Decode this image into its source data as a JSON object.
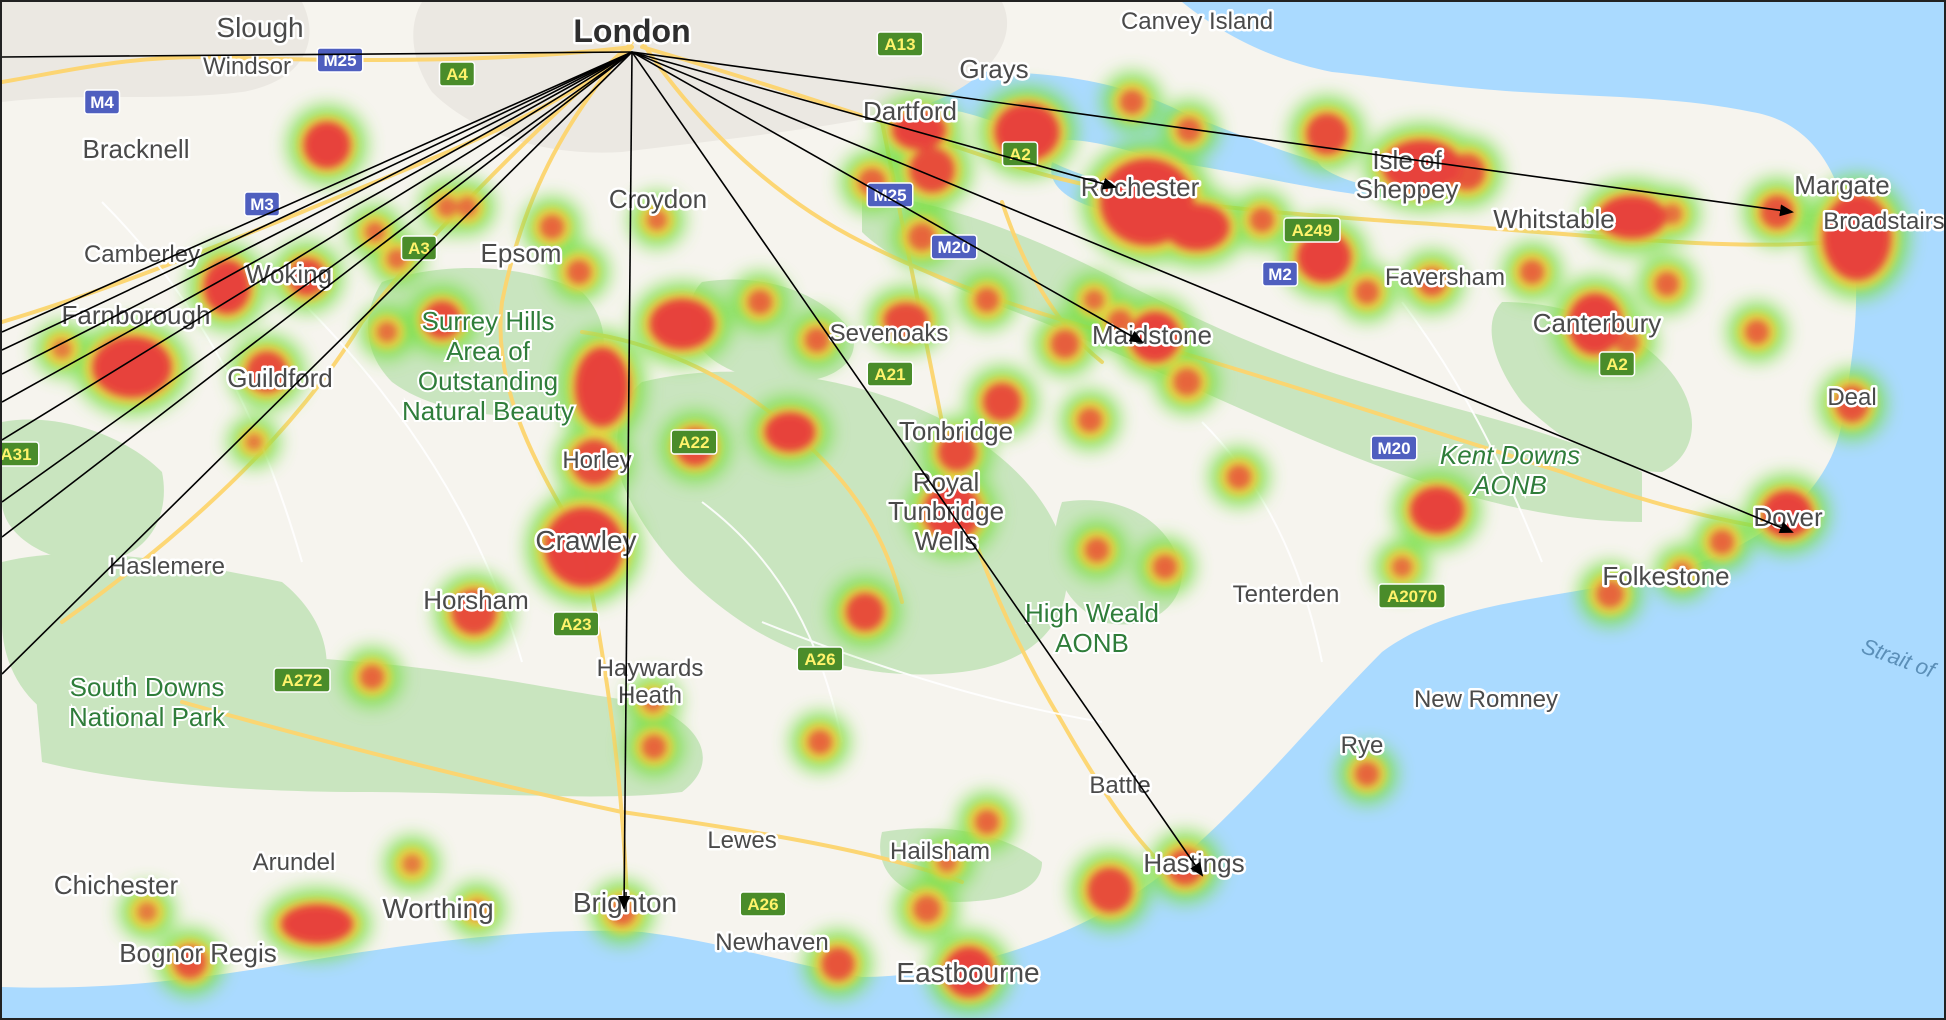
{
  "colors": {
    "sea": "#aadaff",
    "land": "#f6f4ee",
    "park": "#c9e5bf",
    "major_road": "#fdd56e",
    "motorway_badge": "#4f5fbf",
    "a_road_badge": "#4a8c2a",
    "a_road_badge_text": "#fff36b",
    "heat_core": "#e8333a",
    "heat_halo": "#7be049",
    "arrow": "#000000"
  },
  "map": {
    "origin": "London",
    "place_labels": [
      {
        "id": "slough",
        "text": "Slough"
      },
      {
        "id": "windsor",
        "text": "Windsor"
      },
      {
        "id": "london",
        "text": "London"
      },
      {
        "id": "canvey",
        "text": "Canvey Island"
      },
      {
        "id": "grays",
        "text": "Grays"
      },
      {
        "id": "bracknell",
        "text": "Bracknell"
      },
      {
        "id": "dartford",
        "text": "Dartford"
      },
      {
        "id": "rochester",
        "text": "Rochester"
      },
      {
        "id": "sheppey1",
        "text": "Isle of"
      },
      {
        "id": "sheppey2",
        "text": "Sheppey"
      },
      {
        "id": "margate",
        "text": "Margate"
      },
      {
        "id": "broadstairs",
        "text": "Broadstairs"
      },
      {
        "id": "whitstable",
        "text": "Whitstable"
      },
      {
        "id": "croydon",
        "text": "Croydon"
      },
      {
        "id": "camberley",
        "text": "Camberley"
      },
      {
        "id": "epsom",
        "text": "Epsom"
      },
      {
        "id": "woking",
        "text": "Woking"
      },
      {
        "id": "farnborough",
        "text": "Farnborough"
      },
      {
        "id": "guildford",
        "text": "Guildford"
      },
      {
        "id": "faversham",
        "text": "Faversham"
      },
      {
        "id": "sevenoaks",
        "text": "Sevenoaks"
      },
      {
        "id": "maidstone",
        "text": "Maidstone"
      },
      {
        "id": "canterbury",
        "text": "Canterbury"
      },
      {
        "id": "deal",
        "text": "Deal"
      },
      {
        "id": "tonbridge",
        "text": "Tonbridge"
      },
      {
        "id": "horley",
        "text": "Horley"
      },
      {
        "id": "rtw1",
        "text": "Royal"
      },
      {
        "id": "rtw2",
        "text": "Tunbridge"
      },
      {
        "id": "rtw3",
        "text": "Wells"
      },
      {
        "id": "dover",
        "text": "Dover"
      },
      {
        "id": "crawley",
        "text": "Crawley"
      },
      {
        "id": "haslemere",
        "text": "Haslemere"
      },
      {
        "id": "folkestone",
        "text": "Folkestone"
      },
      {
        "id": "horsham",
        "text": "Horsham"
      },
      {
        "id": "tenterden",
        "text": "Tenterden"
      },
      {
        "id": "hh1",
        "text": "Haywards"
      },
      {
        "id": "hh2",
        "text": "Heath"
      },
      {
        "id": "newromney",
        "text": "New Romney"
      },
      {
        "id": "rye",
        "text": "Rye"
      },
      {
        "id": "battle",
        "text": "Battle"
      },
      {
        "id": "arundel",
        "text": "Arundel"
      },
      {
        "id": "lewes",
        "text": "Lewes"
      },
      {
        "id": "hailsham",
        "text": "Hailsham"
      },
      {
        "id": "hastings",
        "text": "Hastings"
      },
      {
        "id": "chichester",
        "text": "Chichester"
      },
      {
        "id": "worthing",
        "text": "Worthing"
      },
      {
        "id": "brighton",
        "text": "Brighton"
      },
      {
        "id": "newhaven",
        "text": "Newhaven"
      },
      {
        "id": "eastbourne",
        "text": "Eastbourne"
      },
      {
        "id": "bognor",
        "text": "Bognor Regis"
      }
    ],
    "park_labels": [
      {
        "id": "surrey1",
        "text": "Surrey Hills"
      },
      {
        "id": "surrey2",
        "text": "Area of"
      },
      {
        "id": "surrey3",
        "text": "Outstanding"
      },
      {
        "id": "surrey4",
        "text": "Natural Beauty"
      },
      {
        "id": "kent1",
        "text": "Kent Downs"
      },
      {
        "id": "kent2",
        "text": "AONB"
      },
      {
        "id": "hw1",
        "text": "High Weald"
      },
      {
        "id": "hw2",
        "text": "AONB"
      },
      {
        "id": "sd1",
        "text": "South Downs"
      },
      {
        "id": "sd2",
        "text": "National Park"
      }
    ],
    "water_labels": [
      {
        "id": "strait",
        "text": "Strait of"
      }
    ],
    "road_badges": [
      {
        "id": "m25a",
        "text": "M25",
        "type": "motorway"
      },
      {
        "id": "m4",
        "text": "M4",
        "type": "motorway"
      },
      {
        "id": "a4",
        "text": "A4",
        "type": "a-road"
      },
      {
        "id": "a13",
        "text": "A13",
        "type": "a-road"
      },
      {
        "id": "m3",
        "text": "M3",
        "type": "motorway"
      },
      {
        "id": "a3",
        "text": "A3",
        "type": "a-road"
      },
      {
        "id": "a2a",
        "text": "A2",
        "type": "a-road"
      },
      {
        "id": "m25b",
        "text": "M25",
        "type": "motorway"
      },
      {
        "id": "m20a",
        "text": "M20",
        "type": "motorway"
      },
      {
        "id": "a249",
        "text": "A249",
        "type": "a-road"
      },
      {
        "id": "m2",
        "text": "M2",
        "type": "motorway"
      },
      {
        "id": "a21",
        "text": "A21",
        "type": "a-road"
      },
      {
        "id": "a22",
        "text": "A22",
        "type": "a-road"
      },
      {
        "id": "a2b",
        "text": "A2",
        "type": "a-road"
      },
      {
        "id": "m20b",
        "text": "M20",
        "type": "motorway"
      },
      {
        "id": "a31",
        "text": "A31",
        "type": "a-road"
      },
      {
        "id": "a2070",
        "text": "A2070",
        "type": "a-road"
      },
      {
        "id": "a23",
        "text": "A23",
        "type": "a-road"
      },
      {
        "id": "a26a",
        "text": "A26",
        "type": "a-road"
      },
      {
        "id": "a272",
        "text": "A272",
        "type": "a-road"
      },
      {
        "id": "a26b",
        "text": "A26",
        "type": "a-road"
      }
    ],
    "route_destinations": [
      "Rochester",
      "Maidstone",
      "Margate",
      "Dover",
      "Hastings",
      "Brighton"
    ],
    "heatmap_hotspots": [
      {
        "id": "woking-area",
        "intensity": 0.9
      },
      {
        "id": "farnborough-area",
        "intensity": 0.95
      },
      {
        "id": "crawley-area",
        "intensity": 1.0
      },
      {
        "id": "rochester-area",
        "intensity": 1.0
      },
      {
        "id": "dartford-area",
        "intensity": 0.95
      },
      {
        "id": "margate-area",
        "intensity": 0.95
      },
      {
        "id": "dover-area",
        "intensity": 0.9
      },
      {
        "id": "eastbourne-area",
        "intensity": 0.85
      },
      {
        "id": "worthing-area",
        "intensity": 0.85
      }
    ]
  }
}
